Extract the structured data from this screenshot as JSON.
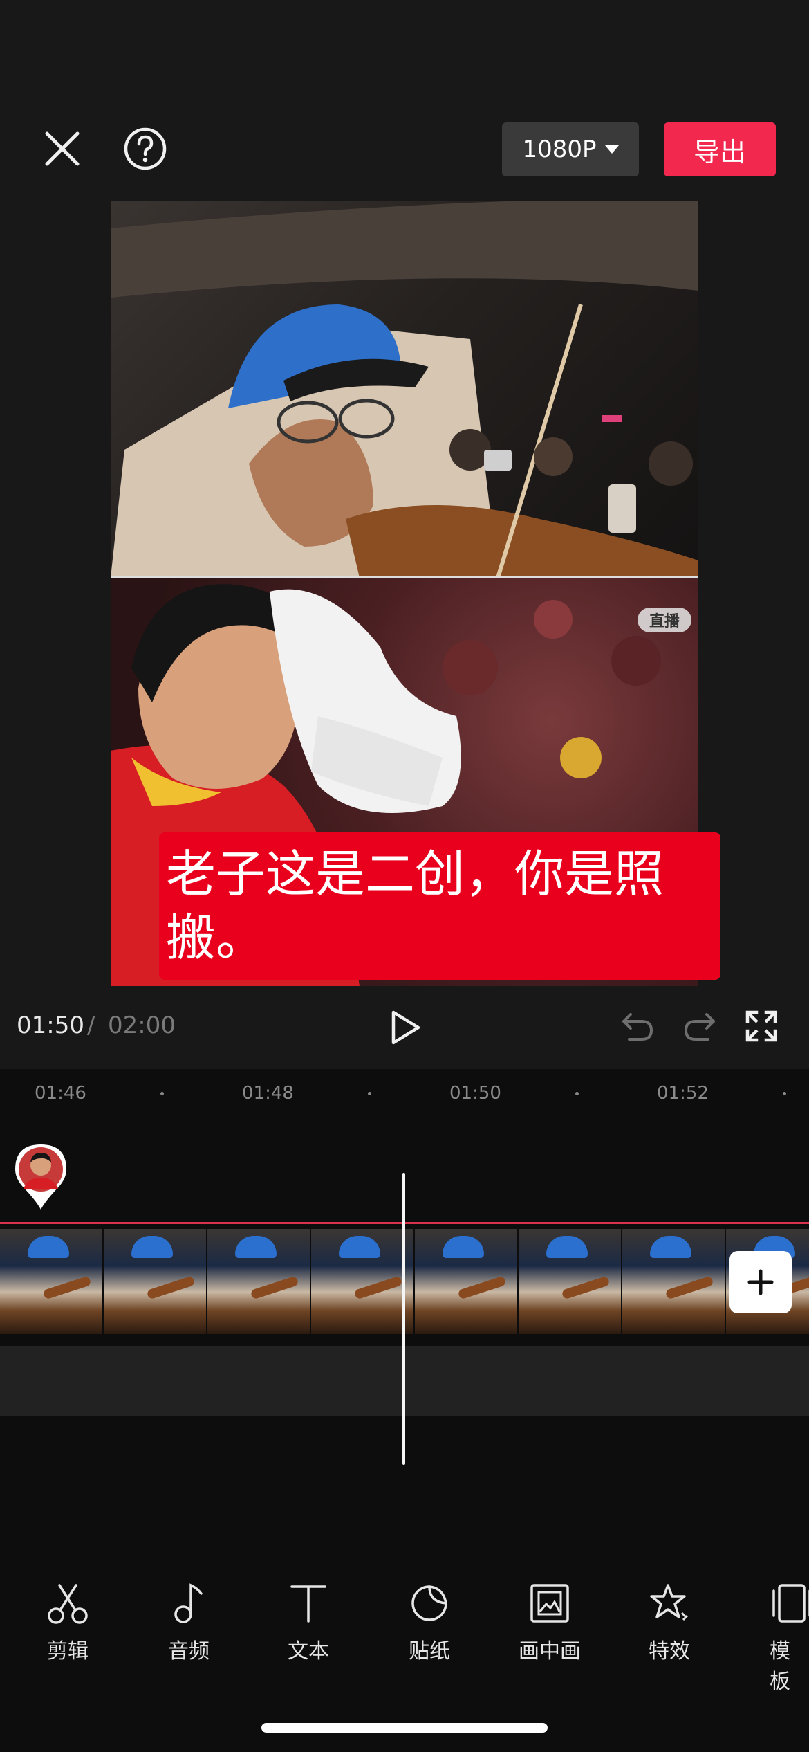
{
  "header": {
    "resolution": "1080P",
    "export_label": "导出"
  },
  "preview": {
    "live_badge": "直播",
    "caption": "老子这是二创，你是照搬。"
  },
  "playback": {
    "current_time": "01:50",
    "separator": "/",
    "total_time": "02:00"
  },
  "timeline": {
    "ruler": [
      "01:46",
      "01:48",
      "01:50",
      "01:52"
    ]
  },
  "toolbar": {
    "items": [
      {
        "label": "剪辑",
        "icon": "scissors-icon"
      },
      {
        "label": "音频",
        "icon": "music-note-icon"
      },
      {
        "label": "文本",
        "icon": "text-icon"
      },
      {
        "label": "贴纸",
        "icon": "sticker-icon"
      },
      {
        "label": "画中画",
        "icon": "picture-in-picture-icon"
      },
      {
        "label": "特效",
        "icon": "effects-star-icon"
      },
      {
        "label": "模板",
        "icon": "template-icon"
      }
    ]
  },
  "colors": {
    "accent": "#f2284f",
    "caption_bg": "#e8001c",
    "timeline_marker": "#d8324a"
  }
}
